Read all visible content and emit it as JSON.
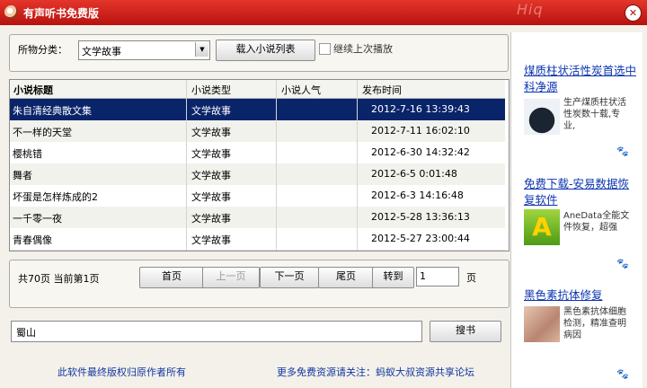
{
  "window": {
    "title": "有声听书免费版",
    "decor_text": "Hiq",
    "close_symbol": "✕"
  },
  "filter": {
    "category_label": "所物分类：",
    "category_value": "文学故事",
    "load_button": "载入小说列表",
    "resume_label": "继续上次播放"
  },
  "table": {
    "headers": [
      "小说标题",
      "小说类型",
      "小说人气",
      "发布时间"
    ],
    "rows": [
      {
        "title": "朱自清经典散文集",
        "type": "文学故事",
        "popularity": "",
        "date": "2012-7-16 13:39:43"
      },
      {
        "title": "不一样的天堂",
        "type": "文学故事",
        "popularity": "",
        "date": "2012-7-11 16:02:10"
      },
      {
        "title": "樱桃错",
        "type": "文学故事",
        "popularity": "",
        "date": "2012-6-30 14:32:42"
      },
      {
        "title": "舞者",
        "type": "文学故事",
        "popularity": "",
        "date": "2012-6-5 0:01:48"
      },
      {
        "title": "坏蛋是怎样炼成的2",
        "type": "文学故事",
        "popularity": "",
        "date": "2012-6-3 14:16:48"
      },
      {
        "title": "一千零一夜",
        "type": "文学故事",
        "popularity": "",
        "date": "2012-5-28 13:36:13"
      },
      {
        "title": "青春偶像",
        "type": "文学故事",
        "popularity": "",
        "date": "2012-5-27 23:00:44"
      }
    ]
  },
  "pager": {
    "info": "共70页  当前第1页",
    "first": "首页",
    "prev": "上一页",
    "next": "下一页",
    "last": "尾页",
    "goto": "转到",
    "page_value": "1",
    "page_unit": "页"
  },
  "search": {
    "value": "蜀山",
    "button": "搜书"
  },
  "footer": {
    "copyright": "此软件最终版权归原作者所有",
    "more": "更多免费资源请关注：蚂蚁大叔资源共享论坛"
  },
  "ads": [
    {
      "title": "煤质柱状活性炭首选中科净源",
      "desc": "生产煤质柱状活性炭数十载,专业,",
      "paw": "🐾"
    },
    {
      "title": "免费下载-安易数据恢复软件",
      "desc": "AneData全能文件恢复，超强",
      "paw": "🐾",
      "logo_letter": "A"
    },
    {
      "title": "黑色素抗体修复",
      "desc": "黑色素抗体细胞检测，精准查明病因",
      "paw": "🐾"
    }
  ],
  "colors": {
    "title_bar": "#c8191a",
    "selection": "#0a246a",
    "link": "#1236a0",
    "ad_link": "#0b34b0"
  }
}
